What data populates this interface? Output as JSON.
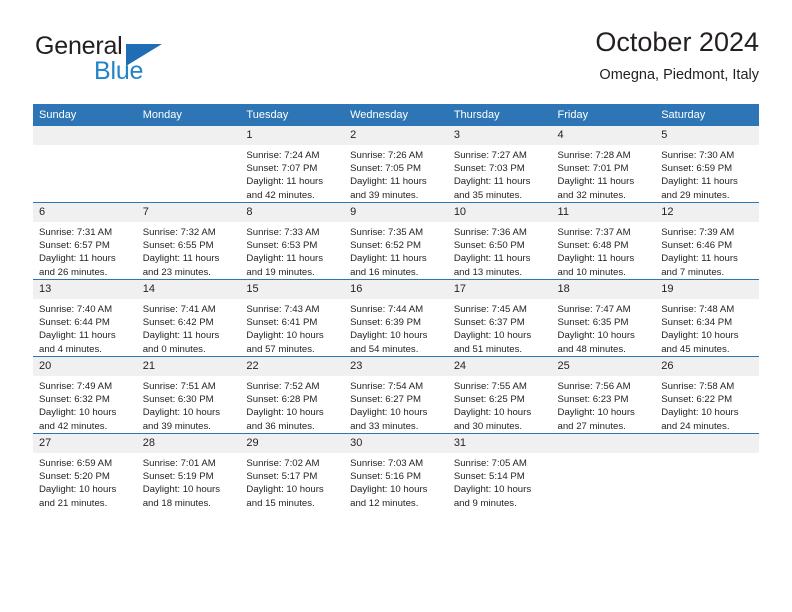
{
  "brand": {
    "word_top": "General",
    "word_bottom": "Blue",
    "triangle_color": "#1f6db5",
    "top_color": "#231f20",
    "bottom_color": "#2283c8"
  },
  "header": {
    "title": "October 2024",
    "subtitle": "Omegna, Piedmont, Italy"
  },
  "theme": {
    "header_bg": "#2e75b6",
    "daynum_bg": "#f0f0f0",
    "row_separator": "#2e75b6",
    "text": "#231f20"
  },
  "weekdays": [
    "Sunday",
    "Monday",
    "Tuesday",
    "Wednesday",
    "Thursday",
    "Friday",
    "Saturday"
  ],
  "calendar": {
    "weeks": [
      [
        {
          "day": "",
          "blank": true,
          "sunrise": "",
          "sunset": "",
          "daylight_1": "",
          "daylight_2": ""
        },
        {
          "day": "",
          "blank": true,
          "sunrise": "",
          "sunset": "",
          "daylight_1": "",
          "daylight_2": ""
        },
        {
          "day": "1",
          "sunrise": "Sunrise: 7:24 AM",
          "sunset": "Sunset: 7:07 PM",
          "daylight_1": "Daylight: 11 hours",
          "daylight_2": "and 42 minutes."
        },
        {
          "day": "2",
          "sunrise": "Sunrise: 7:26 AM",
          "sunset": "Sunset: 7:05 PM",
          "daylight_1": "Daylight: 11 hours",
          "daylight_2": "and 39 minutes."
        },
        {
          "day": "3",
          "sunrise": "Sunrise: 7:27 AM",
          "sunset": "Sunset: 7:03 PM",
          "daylight_1": "Daylight: 11 hours",
          "daylight_2": "and 35 minutes."
        },
        {
          "day": "4",
          "sunrise": "Sunrise: 7:28 AM",
          "sunset": "Sunset: 7:01 PM",
          "daylight_1": "Daylight: 11 hours",
          "daylight_2": "and 32 minutes."
        },
        {
          "day": "5",
          "sunrise": "Sunrise: 7:30 AM",
          "sunset": "Sunset: 6:59 PM",
          "daylight_1": "Daylight: 11 hours",
          "daylight_2": "and 29 minutes."
        }
      ],
      [
        {
          "day": "6",
          "sunrise": "Sunrise: 7:31 AM",
          "sunset": "Sunset: 6:57 PM",
          "daylight_1": "Daylight: 11 hours",
          "daylight_2": "and 26 minutes."
        },
        {
          "day": "7",
          "sunrise": "Sunrise: 7:32 AM",
          "sunset": "Sunset: 6:55 PM",
          "daylight_1": "Daylight: 11 hours",
          "daylight_2": "and 23 minutes."
        },
        {
          "day": "8",
          "sunrise": "Sunrise: 7:33 AM",
          "sunset": "Sunset: 6:53 PM",
          "daylight_1": "Daylight: 11 hours",
          "daylight_2": "and 19 minutes."
        },
        {
          "day": "9",
          "sunrise": "Sunrise: 7:35 AM",
          "sunset": "Sunset: 6:52 PM",
          "daylight_1": "Daylight: 11 hours",
          "daylight_2": "and 16 minutes."
        },
        {
          "day": "10",
          "sunrise": "Sunrise: 7:36 AM",
          "sunset": "Sunset: 6:50 PM",
          "daylight_1": "Daylight: 11 hours",
          "daylight_2": "and 13 minutes."
        },
        {
          "day": "11",
          "sunrise": "Sunrise: 7:37 AM",
          "sunset": "Sunset: 6:48 PM",
          "daylight_1": "Daylight: 11 hours",
          "daylight_2": "and 10 minutes."
        },
        {
          "day": "12",
          "sunrise": "Sunrise: 7:39 AM",
          "sunset": "Sunset: 6:46 PM",
          "daylight_1": "Daylight: 11 hours",
          "daylight_2": "and 7 minutes."
        }
      ],
      [
        {
          "day": "13",
          "sunrise": "Sunrise: 7:40 AM",
          "sunset": "Sunset: 6:44 PM",
          "daylight_1": "Daylight: 11 hours",
          "daylight_2": "and 4 minutes."
        },
        {
          "day": "14",
          "sunrise": "Sunrise: 7:41 AM",
          "sunset": "Sunset: 6:42 PM",
          "daylight_1": "Daylight: 11 hours",
          "daylight_2": "and 0 minutes."
        },
        {
          "day": "15",
          "sunrise": "Sunrise: 7:43 AM",
          "sunset": "Sunset: 6:41 PM",
          "daylight_1": "Daylight: 10 hours",
          "daylight_2": "and 57 minutes."
        },
        {
          "day": "16",
          "sunrise": "Sunrise: 7:44 AM",
          "sunset": "Sunset: 6:39 PM",
          "daylight_1": "Daylight: 10 hours",
          "daylight_2": "and 54 minutes."
        },
        {
          "day": "17",
          "sunrise": "Sunrise: 7:45 AM",
          "sunset": "Sunset: 6:37 PM",
          "daylight_1": "Daylight: 10 hours",
          "daylight_2": "and 51 minutes."
        },
        {
          "day": "18",
          "sunrise": "Sunrise: 7:47 AM",
          "sunset": "Sunset: 6:35 PM",
          "daylight_1": "Daylight: 10 hours",
          "daylight_2": "and 48 minutes."
        },
        {
          "day": "19",
          "sunrise": "Sunrise: 7:48 AM",
          "sunset": "Sunset: 6:34 PM",
          "daylight_1": "Daylight: 10 hours",
          "daylight_2": "and 45 minutes."
        }
      ],
      [
        {
          "day": "20",
          "sunrise": "Sunrise: 7:49 AM",
          "sunset": "Sunset: 6:32 PM",
          "daylight_1": "Daylight: 10 hours",
          "daylight_2": "and 42 minutes."
        },
        {
          "day": "21",
          "sunrise": "Sunrise: 7:51 AM",
          "sunset": "Sunset: 6:30 PM",
          "daylight_1": "Daylight: 10 hours",
          "daylight_2": "and 39 minutes."
        },
        {
          "day": "22",
          "sunrise": "Sunrise: 7:52 AM",
          "sunset": "Sunset: 6:28 PM",
          "daylight_1": "Daylight: 10 hours",
          "daylight_2": "and 36 minutes."
        },
        {
          "day": "23",
          "sunrise": "Sunrise: 7:54 AM",
          "sunset": "Sunset: 6:27 PM",
          "daylight_1": "Daylight: 10 hours",
          "daylight_2": "and 33 minutes."
        },
        {
          "day": "24",
          "sunrise": "Sunrise: 7:55 AM",
          "sunset": "Sunset: 6:25 PM",
          "daylight_1": "Daylight: 10 hours",
          "daylight_2": "and 30 minutes."
        },
        {
          "day": "25",
          "sunrise": "Sunrise: 7:56 AM",
          "sunset": "Sunset: 6:23 PM",
          "daylight_1": "Daylight: 10 hours",
          "daylight_2": "and 27 minutes."
        },
        {
          "day": "26",
          "sunrise": "Sunrise: 7:58 AM",
          "sunset": "Sunset: 6:22 PM",
          "daylight_1": "Daylight: 10 hours",
          "daylight_2": "and 24 minutes."
        }
      ],
      [
        {
          "day": "27",
          "sunrise": "Sunrise: 6:59 AM",
          "sunset": "Sunset: 5:20 PM",
          "daylight_1": "Daylight: 10 hours",
          "daylight_2": "and 21 minutes."
        },
        {
          "day": "28",
          "sunrise": "Sunrise: 7:01 AM",
          "sunset": "Sunset: 5:19 PM",
          "daylight_1": "Daylight: 10 hours",
          "daylight_2": "and 18 minutes."
        },
        {
          "day": "29",
          "sunrise": "Sunrise: 7:02 AM",
          "sunset": "Sunset: 5:17 PM",
          "daylight_1": "Daylight: 10 hours",
          "daylight_2": "and 15 minutes."
        },
        {
          "day": "30",
          "sunrise": "Sunrise: 7:03 AM",
          "sunset": "Sunset: 5:16 PM",
          "daylight_1": "Daylight: 10 hours",
          "daylight_2": "and 12 minutes."
        },
        {
          "day": "31",
          "sunrise": "Sunrise: 7:05 AM",
          "sunset": "Sunset: 5:14 PM",
          "daylight_1": "Daylight: 10 hours",
          "daylight_2": "and 9 minutes."
        },
        {
          "day": "",
          "blank": true,
          "sunrise": "",
          "sunset": "",
          "daylight_1": "",
          "daylight_2": ""
        },
        {
          "day": "",
          "blank": true,
          "sunrise": "",
          "sunset": "",
          "daylight_1": "",
          "daylight_2": ""
        }
      ]
    ]
  }
}
